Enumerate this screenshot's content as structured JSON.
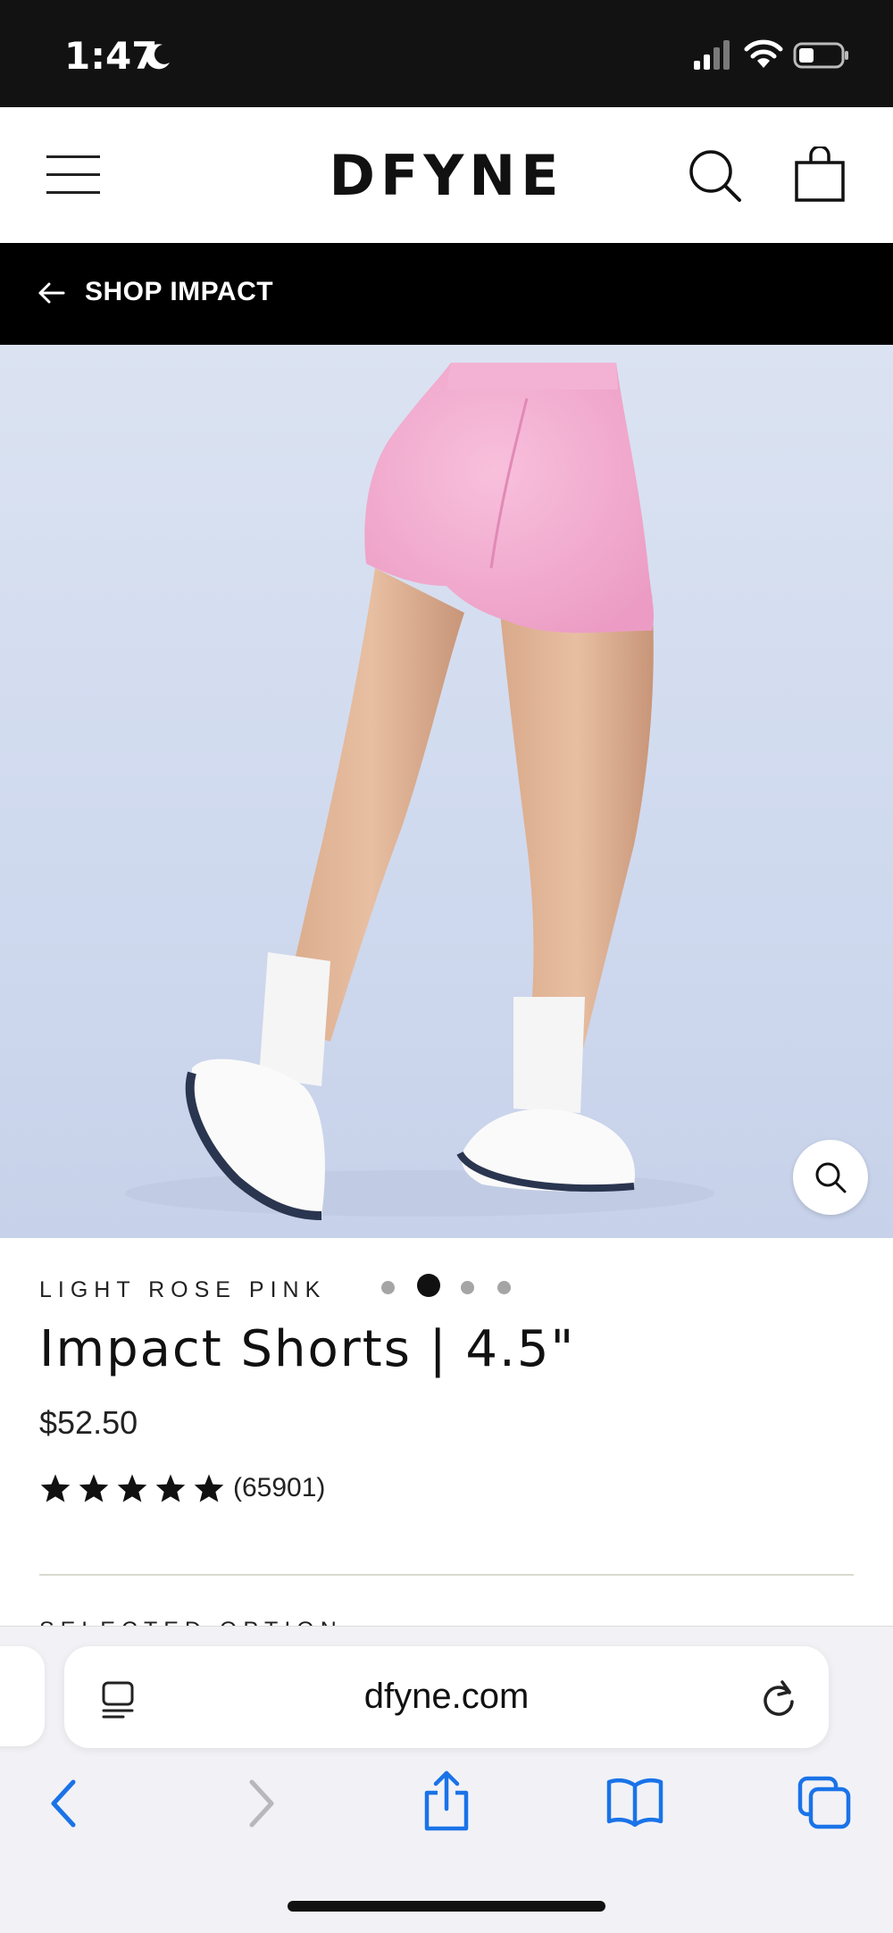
{
  "status_bar": {
    "time": "1:47"
  },
  "header": {
    "logo": "DFYNE"
  },
  "shop_bar": {
    "label": "SHOP IMPACT"
  },
  "product": {
    "color": "LIGHT ROSE PINK",
    "title": "Impact Shorts | 4.5\"",
    "price": "$52.50",
    "rating_stars": 5,
    "review_count": "(65901)",
    "image_index": 2,
    "image_total": 4
  },
  "section": {
    "selected_option_label": "SELECTED OPTION"
  },
  "browser": {
    "url": "dfyne.com"
  },
  "colors": {
    "status_bar_bg": "#121212",
    "shop_bar_bg": "#000000",
    "accent_blue": "#1a73e8",
    "shorts_pink": "#f4aad0"
  },
  "icons": [
    "moon-icon",
    "signal-icon",
    "wifi-icon",
    "battery-icon",
    "menu-icon",
    "search-icon",
    "bag-icon",
    "back-arrow-icon",
    "zoom-icon",
    "star-icon",
    "reader-icon",
    "reload-icon",
    "back-icon",
    "forward-icon",
    "share-icon",
    "bookmarks-icon",
    "tabs-icon"
  ]
}
